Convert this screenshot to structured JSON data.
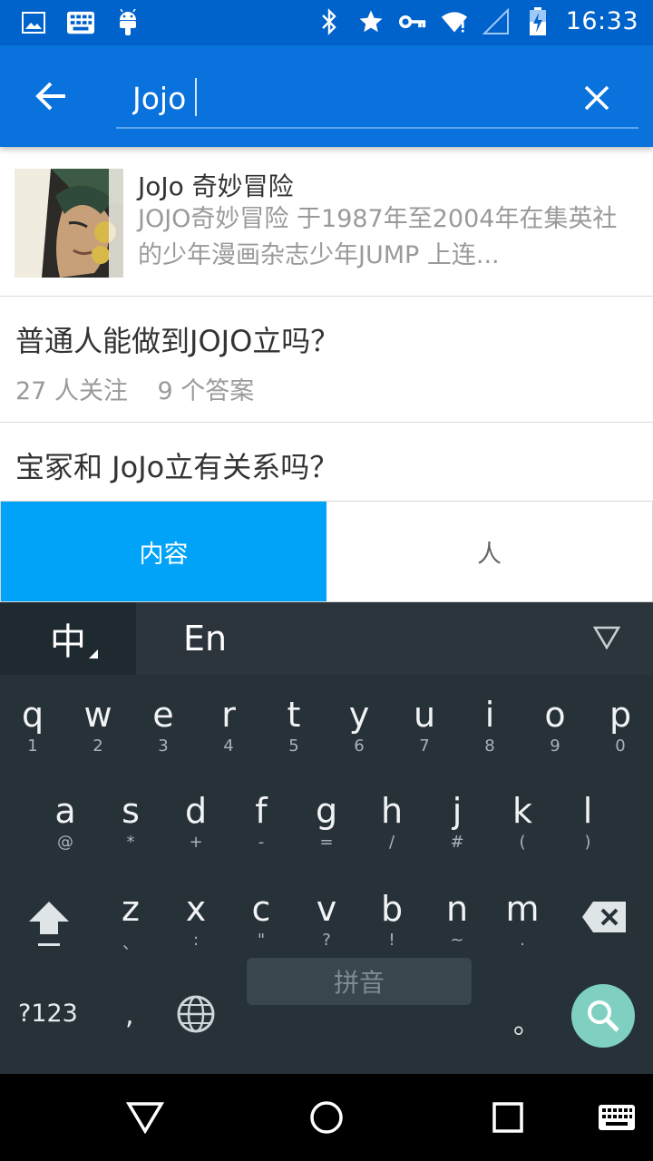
{
  "status_bar": {
    "time": "16:33",
    "left_icons": [
      "image-icon",
      "keyboard-grid-icon",
      "android-icon"
    ],
    "right_icons": [
      "bluetooth-icon",
      "star-icon",
      "vpn-key-icon",
      "wifi-icon",
      "cell-signal-icon",
      "battery-charging-icon"
    ]
  },
  "search": {
    "query": "Jojo",
    "back_icon": "arrow-left-icon",
    "clear_icon": "close-icon"
  },
  "results": {
    "topic": {
      "title": "JoJo 奇妙冒险",
      "description": "JOJO奇妙冒险 于1987年至2004年在集英社的少年漫画杂志少年JUMP 上连..."
    },
    "questions": [
      {
        "title": "普通人能做到JOJO立吗？",
        "followers": "27 人关注",
        "answers": "9 个答案"
      },
      {
        "title": "宝冢和 JoJo立有关系吗？",
        "followers": "",
        "answers": ""
      }
    ]
  },
  "tabs": [
    {
      "label": "内容",
      "active": true
    },
    {
      "label": "人",
      "active": false
    }
  ],
  "keyboard": {
    "mode_zh": "中",
    "mode_en": "En",
    "row1": [
      [
        "q",
        "1"
      ],
      [
        "w",
        "2"
      ],
      [
        "e",
        "3"
      ],
      [
        "r",
        "4"
      ],
      [
        "t",
        "5"
      ],
      [
        "y",
        "6"
      ],
      [
        "u",
        "7"
      ],
      [
        "i",
        "8"
      ],
      [
        "o",
        "9"
      ],
      [
        "p",
        "0"
      ]
    ],
    "row2": [
      [
        "a",
        "@"
      ],
      [
        "s",
        "*"
      ],
      [
        "d",
        "+"
      ],
      [
        "f",
        "-"
      ],
      [
        "g",
        "="
      ],
      [
        "h",
        "/"
      ],
      [
        "j",
        "#"
      ],
      [
        "k",
        "("
      ],
      [
        "l",
        ")"
      ]
    ],
    "row3": [
      [
        "z",
        "、"
      ],
      [
        "x",
        ":"
      ],
      [
        "c",
        "\""
      ],
      [
        "v",
        "?"
      ],
      [
        "b",
        "!"
      ],
      [
        "n",
        "~"
      ],
      [
        "m",
        "."
      ]
    ],
    "symbols_label": "?123",
    "comma_label": ",",
    "space_label": "拼音",
    "period_label": "。"
  },
  "colors": {
    "status_bar": "#0063cc",
    "app_bar": "#0a72dc",
    "tab_active": "#00a3f7",
    "keyboard_bg": "#263238",
    "search_key": "#7fd0c0"
  }
}
